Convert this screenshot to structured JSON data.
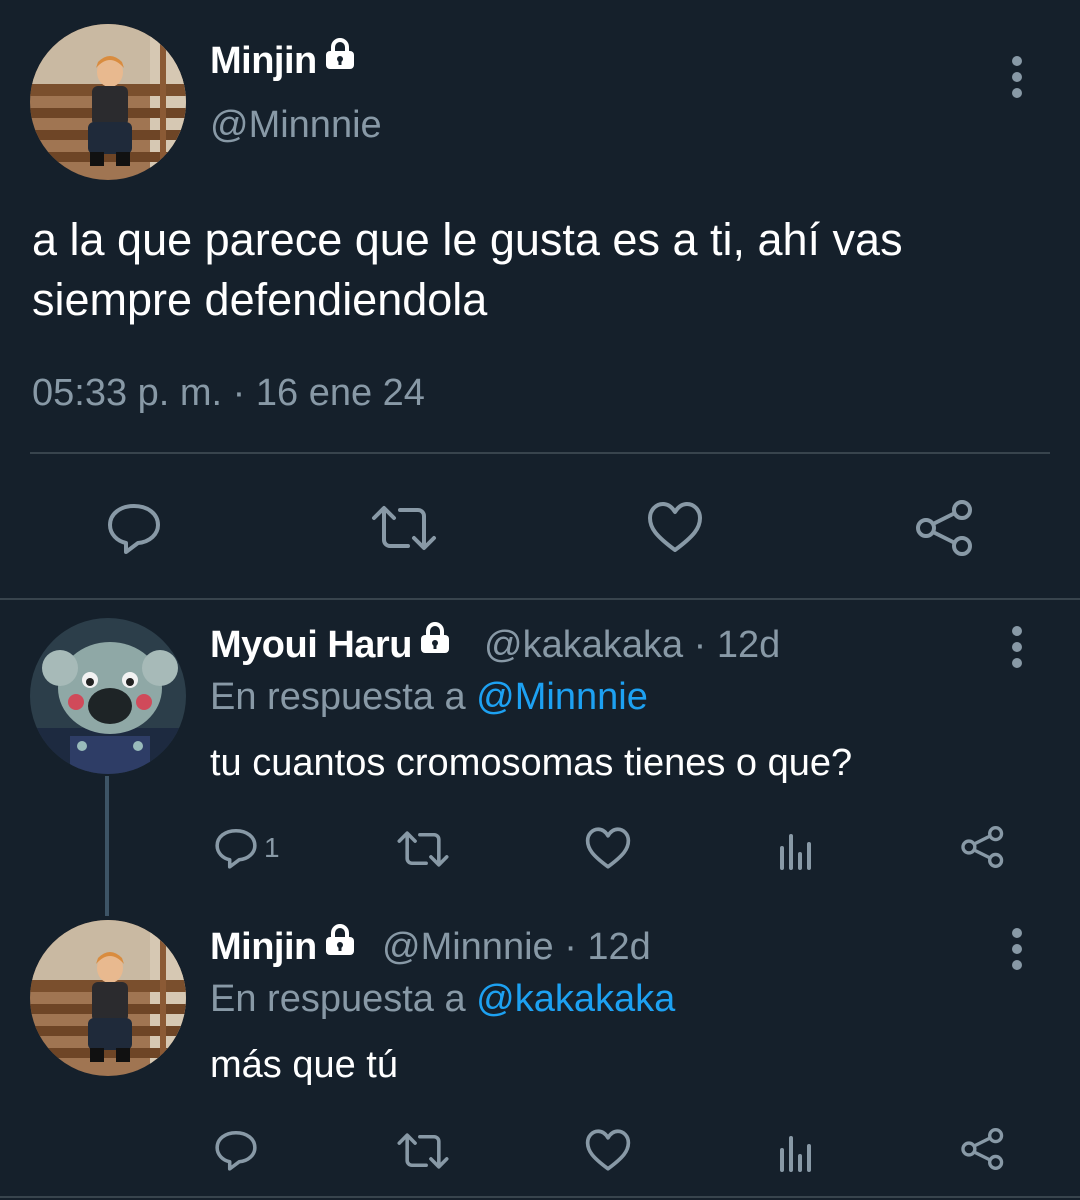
{
  "main_tweet": {
    "name": "Minjin",
    "handle": "@Minnnie",
    "text": "a la que parece que le gusta es a ti, ahí vas siempre defendiendola",
    "timestamp": "05:33 p. m. · 16 ene 24"
  },
  "replies": [
    {
      "name": "Myoui Haru",
      "handle_time": "@kakakaka · 12d",
      "reply_prefix": "En respuesta a ",
      "reply_to": "@Minnnie",
      "text": "tu cuantos cromosomas tienes o que?",
      "reply_count": "1"
    },
    {
      "name": "Minjin",
      "handle_time": "@Minnnie · 12d",
      "reply_prefix": "En respuesta a ",
      "reply_to": "@kakakaka",
      "text": "más que tú",
      "reply_count": ""
    }
  ],
  "icons": {
    "lock": "lock-icon",
    "more": "more-vertical-icon",
    "reply": "reply-icon",
    "retweet": "retweet-icon",
    "like": "heart-icon",
    "analytics": "analytics-icon",
    "share": "share-icon"
  },
  "colors": {
    "background": "#15202b",
    "text": "#ffffff",
    "secondary": "#8899a6",
    "link": "#1da1f2",
    "divider": "#38444d"
  }
}
